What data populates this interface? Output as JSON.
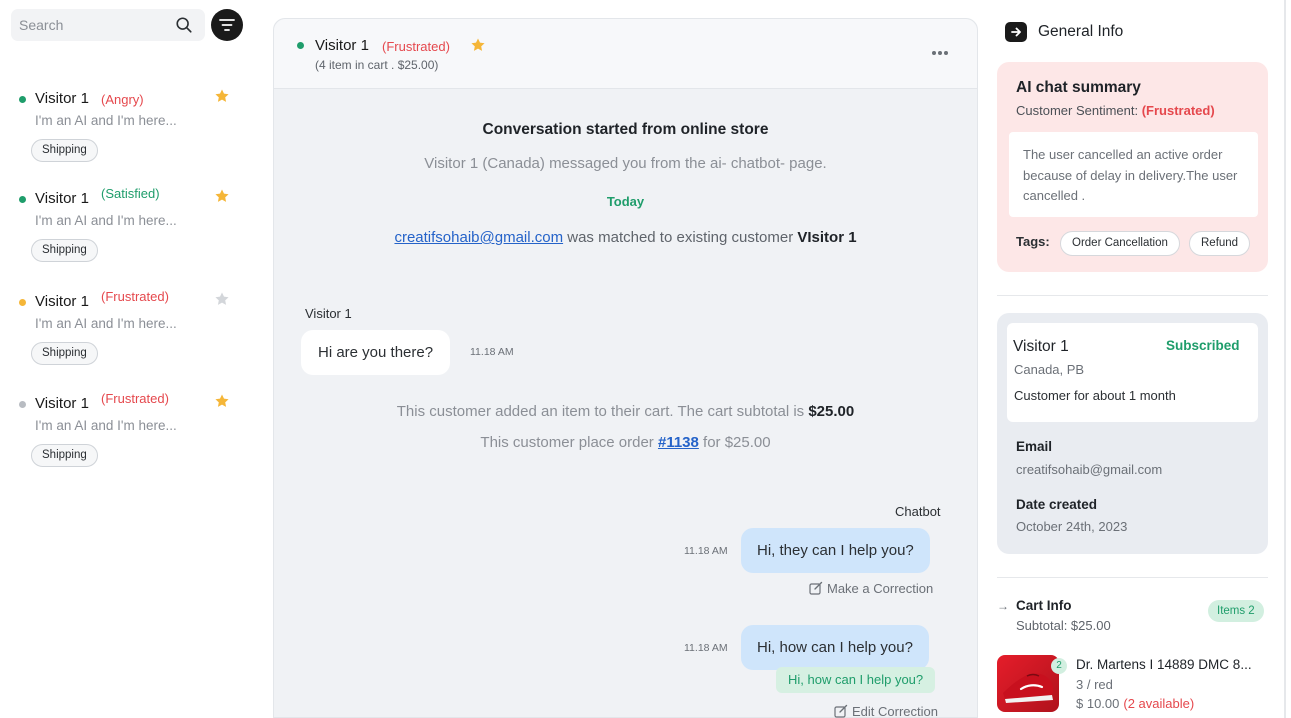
{
  "search": {
    "placeholder": "Search"
  },
  "conversations": [
    {
      "name": "Visitor 1",
      "mood": "(Angry)",
      "mood_color": "#e5484d",
      "dot_color": "#1f9d6b",
      "starred": true,
      "preview": "I'm an AI and I'm here...",
      "tag": "Shipping"
    },
    {
      "name": "Visitor 1",
      "mood": "(Satisfied)",
      "mood_color": "#1f9d6b",
      "dot_color": "#1f9d6b",
      "starred": true,
      "preview": "I'm an AI and I'm here...",
      "tag": "Shipping"
    },
    {
      "name": "Visitor 1",
      "mood": "(Frustrated)",
      "mood_color": "#e5484d",
      "dot_color": "#f5b638",
      "starred": false,
      "preview": "I'm an AI and I'm here...",
      "tag": "Shipping"
    },
    {
      "name": "Visitor 1",
      "mood": "(Frustrated)",
      "mood_color": "#e5484d",
      "dot_color": "#b8bcc2",
      "starred": true,
      "preview": "I'm an AI and I'm here...",
      "tag": "Shipping"
    }
  ],
  "chat": {
    "header": {
      "name": "Visitor 1",
      "mood": "(Frustrated)",
      "subtitle": "(4 item in cart . $25.00)"
    },
    "start_title": "Conversation started from online store",
    "start_sub": "Visitor 1 (Canada) messaged you from the ai- chatbot- page.",
    "today": "Today",
    "matched": {
      "email": "creatifsohaib@gmail.com",
      "middle": " was matched to existing customer ",
      "customer": "VIsitor 1"
    },
    "visitor_label": "Visitor 1",
    "visitor_message": "Hi are you there?",
    "visitor_time": "11.18 AM",
    "event_cart": {
      "text": "This customer added an item to their cart. The cart subtotal is ",
      "amount": "$25.00"
    },
    "event_order": {
      "prefix": "This customer place order ",
      "order": "#1138",
      "suffix": "  for $25.00"
    },
    "bot_label": "Chatbot",
    "bot_messages": [
      {
        "time": "11.18 AM",
        "text": "Hi, they can I help you?",
        "action": "Make a Correction"
      },
      {
        "time": "11.18 AM",
        "text": "Hi, how can I help you?",
        "correction": "Hi, how can I help you?",
        "action": "Edit Correction"
      }
    ]
  },
  "general_info": {
    "title": "General Info",
    "summary": {
      "title": "AI chat summary",
      "sentiment_label": "Customer Sentiment: ",
      "sentiment_value": "(Frustrated)",
      "text": "The user cancelled an active order because of delay in delivery.The user cancelled .",
      "tags_label": "Tags:",
      "tags": [
        "Order Cancellation",
        "Refund"
      ]
    },
    "customer": {
      "name": "Visitor 1",
      "status": "Subscribed",
      "location": "Canada, PB",
      "since": "Customer for about 1 month",
      "email_label": "Email",
      "email": "creatifsohaib@gmail.com",
      "date_label": "Date created",
      "date": "October 24th, 2023"
    },
    "cart": {
      "title": "Cart Info",
      "subtotal": "Subtotal: $25.00",
      "items_badge": "Items 2",
      "product": {
        "qty": "2",
        "name": "Dr. Martens I 14889 DMC 8...",
        "variant": "3 / red",
        "price": "$ 10.00",
        "availability": "(2 available)"
      }
    }
  },
  "colors": {
    "accent_green": "#1f9d6b",
    "alert_red": "#e5484d",
    "link_blue": "#2563c9",
    "bubble_blue": "#cfe5fb",
    "summary_bg": "#fde7e7"
  },
  "icons": [
    "search-icon",
    "filter-icon",
    "star-icon",
    "more-icon",
    "edit-icon",
    "arrow-right-icon",
    "sneaker-image"
  ]
}
